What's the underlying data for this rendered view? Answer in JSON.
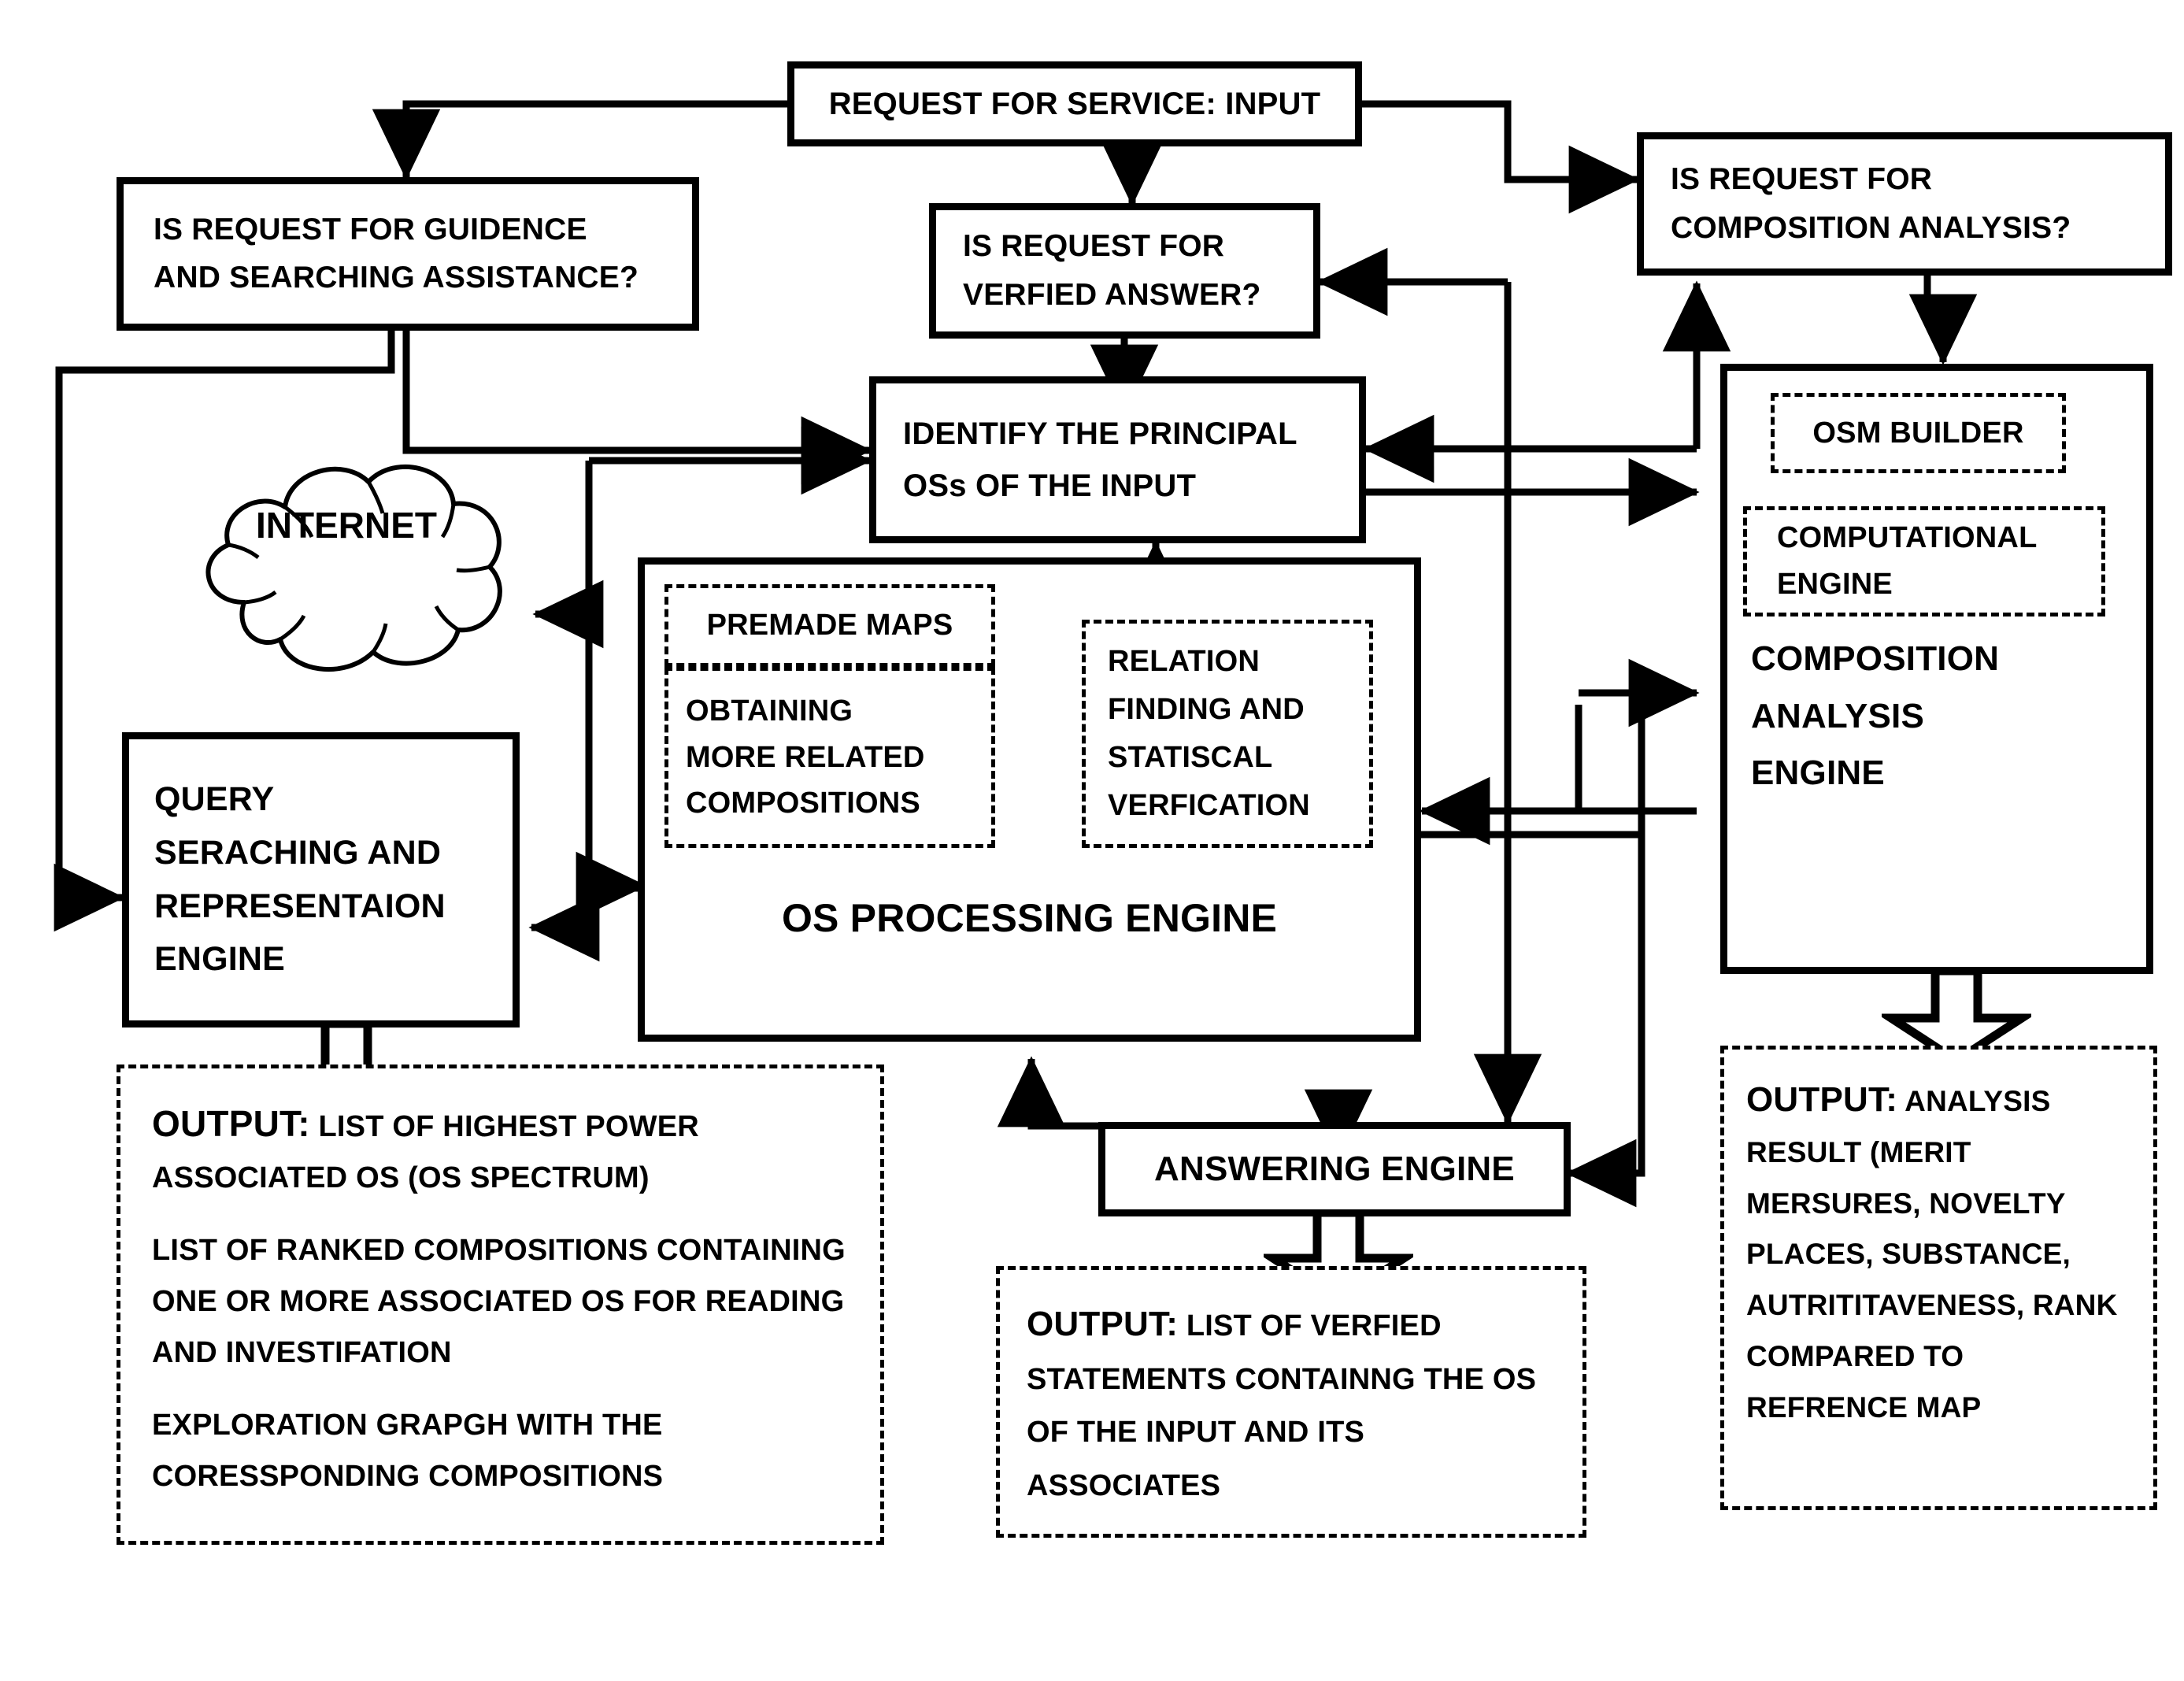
{
  "diagram": {
    "title": "OS Service Request Processing Architecture",
    "nodes": {
      "request_input": {
        "label": "REQUEST FOR SERVICE: INPUT"
      },
      "guidance": {
        "line1": "IS REQUEST FOR GUIDENCE",
        "line2": "AND SEARCHING ASSISTANCE?"
      },
      "verified": {
        "line1": "IS REQUEST FOR",
        "line2": "VERFIED ANSWER?"
      },
      "composition_q": {
        "line1": "IS REQUEST FOR",
        "line2": "COMPOSITION ANALYSIS?"
      },
      "identify": {
        "line1": "IDENTIFY THE PRINCIPAL",
        "line2": "OSs OF THE INPUT"
      },
      "internet": {
        "label": "INTERNET"
      },
      "query_engine": {
        "line1": "QUERY",
        "line2": "SERACHING AND",
        "line3": "REPRESENTAION",
        "line4": "ENGINE"
      },
      "os_processing": {
        "title": "OS PROCESSING ENGINE"
      },
      "premade_maps": {
        "label": "PREMADE MAPS"
      },
      "obtaining": {
        "line1": "OBTAINING",
        "line2": "MORE RELATED",
        "line3": "COMPOSITIONS"
      },
      "relation": {
        "line1": "RELATION",
        "line2": "FINDING AND",
        "line3": "STATISCAL",
        "line4": "VERFICATION"
      },
      "composition_engine": {
        "line1": "COMPOSITION",
        "line2": "ANALYSIS",
        "line3": "ENGINE"
      },
      "osm_builder": {
        "label": "OSM BUILDER"
      },
      "computational_engine": {
        "line1": "COMPUTATIONAL",
        "line2": "ENGINE"
      },
      "answering_engine": {
        "label": "ANSWERING ENGINE"
      },
      "output_left": {
        "prefix": "OUTPUT",
        "colon": ":",
        "para1": " LIST OF HIGHEST POWER ASSOCIATED OS (OS SPECTRUM)",
        "para2": "LIST OF RANKED COMPOSITIONS CONTAINING ONE OR MORE ASSOCIATED OS FOR READING AND INVESTIFATION",
        "para3": "EXPLORATION GRAPGH WITH THE CORESSPONDING COMPOSITIONS"
      },
      "output_center": {
        "prefix": "OUTPUT",
        "colon": ":",
        "body": " LIST OF VERFIED STATEMENTS CONTAINNG THE OS OF THE INPUT AND ITS ASSOCIATES"
      },
      "output_right": {
        "prefix": "OUTPUT",
        "colon": ":",
        "body": " ANALYSIS RESULT (MERIT MERSURES, NOVELTY PLACES, SUBSTANCE, AUTRITITAVENESS, RANK COMPARED TO REFRENCE MAP"
      }
    },
    "colors": {
      "stroke": "#000000",
      "background": "#ffffff"
    }
  }
}
